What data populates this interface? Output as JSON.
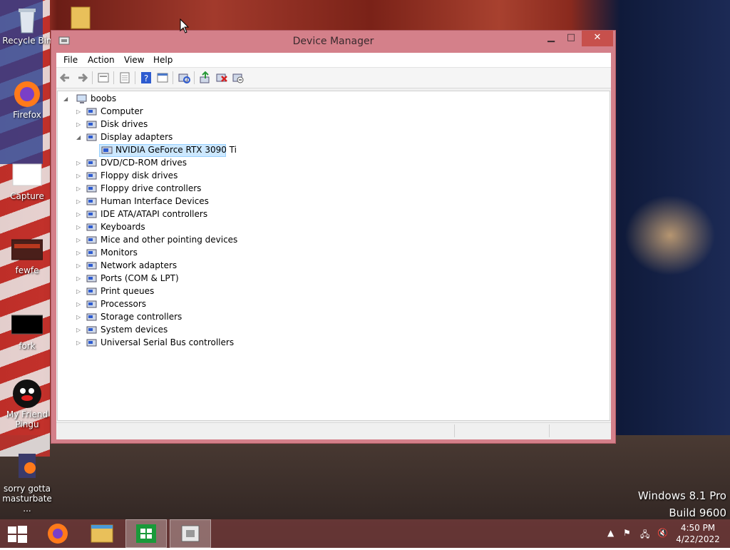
{
  "desktop": {
    "icons": [
      {
        "label": "Recycle Bin",
        "icon": "recycle-bin-icon"
      },
      {
        "label": "Firefox",
        "icon": "firefox-icon"
      },
      {
        "label": "Capture",
        "icon": "image-file-icon"
      },
      {
        "label": "fewfe",
        "icon": "image-file-icon"
      },
      {
        "label": "fork",
        "icon": "image-file-icon"
      },
      {
        "label": "My Friend Pingu",
        "icon": "pingu-icon"
      },
      {
        "label": "sorry gotta masturbate ...",
        "icon": "shortcut-icon"
      }
    ],
    "watermark": {
      "edition": "Windows 8.1 Pro",
      "build": "Build 9600"
    }
  },
  "window": {
    "title": "Device Manager",
    "controls": {
      "minimize": "▁",
      "maximize": "□",
      "close": "✕"
    },
    "menu": [
      "File",
      "Action",
      "View",
      "Help"
    ],
    "toolbar_icons": [
      "back-icon",
      "forward-icon",
      "properties-icon",
      "update-list-icon",
      "help-icon",
      "show-hidden-icon",
      "scan-hardware-icon",
      "update-driver-icon",
      "uninstall-icon",
      "disable-device-icon"
    ]
  },
  "tree": {
    "root": "boobs",
    "categories": [
      {
        "label": "Computer",
        "expanded": false
      },
      {
        "label": "Disk drives",
        "expanded": false
      },
      {
        "label": "Display adapters",
        "expanded": true,
        "children": [
          "NVIDIA GeForce RTX 3090 Ti"
        ]
      },
      {
        "label": "DVD/CD-ROM drives",
        "expanded": false
      },
      {
        "label": "Floppy disk drives",
        "expanded": false
      },
      {
        "label": "Floppy drive controllers",
        "expanded": false
      },
      {
        "label": "Human Interface Devices",
        "expanded": false
      },
      {
        "label": "IDE ATA/ATAPI controllers",
        "expanded": false
      },
      {
        "label": "Keyboards",
        "expanded": false
      },
      {
        "label": "Mice and other pointing devices",
        "expanded": false
      },
      {
        "label": "Monitors",
        "expanded": false
      },
      {
        "label": "Network adapters",
        "expanded": false
      },
      {
        "label": "Ports (COM & LPT)",
        "expanded": false
      },
      {
        "label": "Print queues",
        "expanded": false
      },
      {
        "label": "Processors",
        "expanded": false
      },
      {
        "label": "Storage controllers",
        "expanded": false
      },
      {
        "label": "System devices",
        "expanded": false
      },
      {
        "label": "Universal Serial Bus controllers",
        "expanded": false
      }
    ]
  },
  "taskbar": {
    "apps": [
      "start-icon",
      "firefox-icon",
      "file-explorer-icon",
      "store-icon",
      "device-manager-icon"
    ],
    "clock": {
      "time": "4:50 PM",
      "date": "4/22/2022"
    },
    "tray_icons": [
      "show-hidden-icons",
      "flag-icon",
      "network-icon",
      "volume-muted-icon"
    ]
  },
  "colors": {
    "window_frame": "#d4808a",
    "selection": "#cce8ff",
    "close_button": "#c7504c"
  }
}
